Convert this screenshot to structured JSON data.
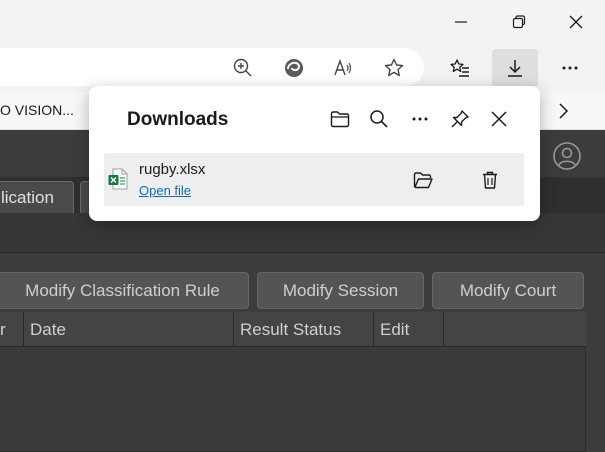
{
  "favorites": {
    "truncated_item": "O VISION..."
  },
  "tabs": {
    "partial_tab": "lication"
  },
  "toolbar_buttons": [
    {
      "label": "Modify Classification Rule"
    },
    {
      "label": "Modify Session"
    },
    {
      "label": "Modify Court"
    }
  ],
  "table": {
    "columns": [
      "r",
      "Date",
      "Result Status",
      "Edit"
    ]
  },
  "downloads": {
    "title": "Downloads",
    "items": [
      {
        "file_name": "rugby.xlsx",
        "action_label": "Open file",
        "file_type_icon": "excel-file-icon"
      }
    ]
  },
  "icons": {
    "window": [
      "minimize-icon",
      "restore-icon",
      "close-icon"
    ],
    "toolbar": [
      "zoom-in-icon",
      "edge-copilot-icon",
      "read-aloud-icon",
      "favorite-star-icon",
      "favorites-list-icon",
      "downloads-icon",
      "more-icon"
    ],
    "flyout": [
      "open-folder-icon",
      "search-icon",
      "more-icon",
      "pin-icon",
      "close-icon"
    ],
    "item": [
      "show-in-folder-icon",
      "delete-icon"
    ]
  },
  "colors": {
    "link": "#0f6cbd",
    "excel_green": "#107c41",
    "app_dark": "#3a3a3a",
    "chrome_light": "#f3f3f3"
  }
}
